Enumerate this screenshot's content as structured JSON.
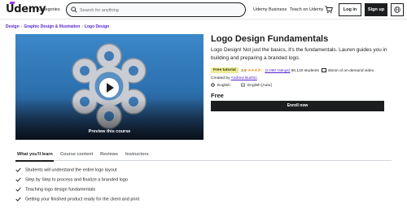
{
  "header": {
    "logo": "Udemy",
    "categories": "Categories",
    "search_placeholder": "Search for anything",
    "udemy_business": "Udemy Business",
    "teach": "Teach on Udemy",
    "login": "Log in",
    "signup": "Sign up"
  },
  "breadcrumb": [
    "Design",
    "Graphic Design & Illustration",
    "Logo Design"
  ],
  "preview": {
    "label": "Preview this course"
  },
  "course": {
    "title": "Logo Design Fundamentals",
    "description": "Logo Design! Not just the basics, it's the fundamentals. Lauren guides you in building and preparing a branded logo.",
    "badge": "Free tutorial",
    "rating": "3.9",
    "stars": "★★★★☆",
    "stars_value": 3.9,
    "ratings_count": "(2,060 ratings)",
    "students": "60,120 students",
    "video_length": "46min of on-demand video",
    "created_by_label": "Created by",
    "creator": "Andrew Bushin",
    "language": "English",
    "captions": "English [Auto]",
    "price": "Free",
    "enroll": "Enroll now"
  },
  "tabs": [
    "What you'll learn",
    "Course content",
    "Reviews",
    "Instructors"
  ],
  "learn_items": [
    "Students will understand the entire logo layout",
    "Step by Step to process and finalize a branded logo",
    "Teaching logo design fundamentals",
    "Getting your finished product ready for the client and print"
  ],
  "colors": {
    "brand_purple": "#a435f0",
    "link_purple": "#5624d0",
    "dark": "#1c1d1f",
    "badge_bg": "#eceb98",
    "rating": "#b4690e"
  }
}
